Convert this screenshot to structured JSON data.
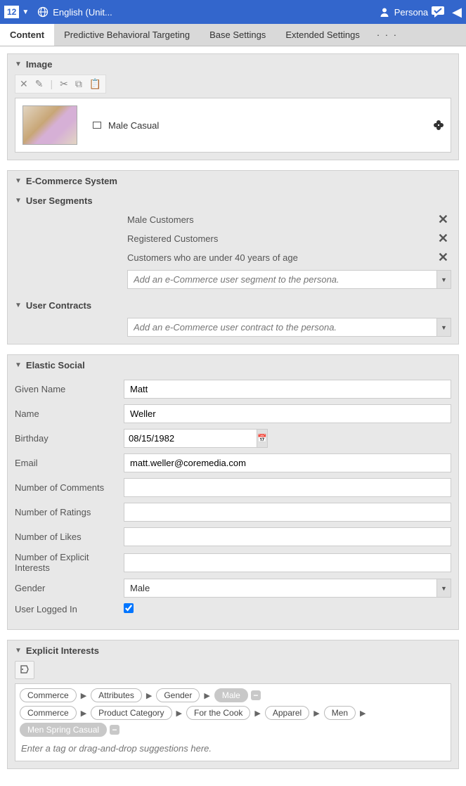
{
  "topbar": {
    "logo": "12",
    "locale": "English (Unit...",
    "persona_label": "Persona"
  },
  "tabs": {
    "items": [
      "Content",
      "Predictive Behavioral Targeting",
      "Base Settings",
      "Extended Settings"
    ],
    "active": 0
  },
  "image_section": {
    "title": "Image",
    "item_label": "Male Casual"
  },
  "ecommerce": {
    "title": "E-Commerce System",
    "user_segments": {
      "title": "User Segments",
      "items": [
        "Male Customers",
        "Registered Customers",
        "Customers who are under 40 years of age"
      ],
      "placeholder": "Add an e-Commerce user segment to the persona."
    },
    "user_contracts": {
      "title": "User Contracts",
      "placeholder": "Add an e-Commerce user contract to the persona."
    }
  },
  "elastic": {
    "title": "Elastic Social",
    "given_name": {
      "label": "Given Name",
      "value": "Matt"
    },
    "name": {
      "label": "Name",
      "value": "Weller"
    },
    "birthday": {
      "label": "Birthday",
      "value": "08/15/1982"
    },
    "email": {
      "label": "Email",
      "value": "matt.weller@coremedia.com"
    },
    "num_comments": {
      "label": "Number of Comments",
      "value": ""
    },
    "num_ratings": {
      "label": "Number of Ratings",
      "value": ""
    },
    "num_likes": {
      "label": "Number of Likes",
      "value": ""
    },
    "num_explicit": {
      "label": "Number of Explicit Interests",
      "value": ""
    },
    "gender": {
      "label": "Gender",
      "value": "Male"
    },
    "logged_in": {
      "label": "User Logged In",
      "checked": true
    }
  },
  "explicit": {
    "title": "Explicit Interests",
    "rows": [
      [
        "Commerce",
        "Attributes",
        "Gender",
        "Male"
      ],
      [
        "Commerce",
        "Product Category",
        "For the Cook",
        "Apparel",
        "Men",
        "Men Spring Casual"
      ]
    ],
    "placeholder": "Enter a tag or drag-and-drop suggestions here."
  }
}
